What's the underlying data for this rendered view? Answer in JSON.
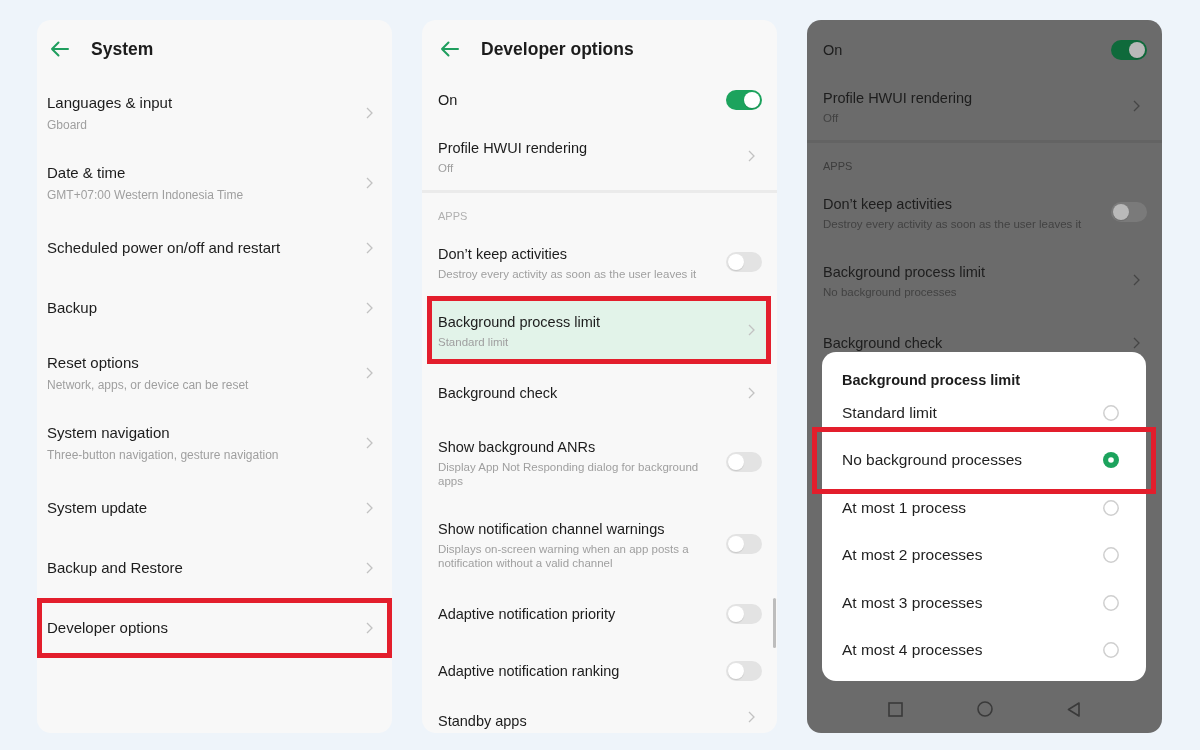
{
  "panels": [
    {
      "header": {
        "title": "System"
      },
      "items": [
        {
          "kind": "link",
          "title": "Languages & input",
          "subtitle": "Gboard",
          "highlighted": false
        },
        {
          "kind": "link",
          "title": "Date & time",
          "subtitle": "GMT+07:00 Western Indonesia Time",
          "highlighted": false
        },
        {
          "kind": "link",
          "title": "Scheduled power on/off and restart",
          "highlighted": false
        },
        {
          "kind": "link",
          "title": "Backup",
          "highlighted": false
        },
        {
          "kind": "link",
          "title": "Reset options",
          "subtitle": "Network, apps, or device can be reset",
          "highlighted": false
        },
        {
          "kind": "link",
          "title": "System navigation",
          "subtitle": "Three-button navigation, gesture navigation",
          "highlighted": false
        },
        {
          "kind": "link",
          "title": "System update",
          "highlighted": false
        },
        {
          "kind": "link",
          "title": "Backup and Restore",
          "highlighted": false
        },
        {
          "kind": "link",
          "title": "Developer options",
          "highlighted": true
        }
      ]
    },
    {
      "header": {
        "title": "Developer options"
      },
      "master_switch": {
        "title": "On",
        "on": true
      },
      "scrollbar": true,
      "items": [
        {
          "kind": "link",
          "title": "Profile HWUI rendering",
          "subtitle": "Off",
          "highlighted": false,
          "pressed": false
        },
        {
          "kind": "divider"
        },
        {
          "kind": "section",
          "title": "APPS"
        },
        {
          "kind": "switch",
          "title": "Don’t keep activities",
          "subtitle": "Destroy every activity as soon as the user leaves it",
          "on": false,
          "highlighted": false,
          "pressed": false
        },
        {
          "kind": "link",
          "title": "Background process limit",
          "subtitle": "Standard limit",
          "highlighted": true,
          "pressed": true
        },
        {
          "kind": "link",
          "title": "Background check",
          "highlighted": false,
          "pressed": false
        },
        {
          "kind": "switch",
          "title": "Show background ANRs",
          "subtitle": "Display App Not Responding dialog for background apps",
          "on": false,
          "highlighted": false,
          "pressed": false
        },
        {
          "kind": "switch",
          "title": "Show notification channel warnings",
          "subtitle": "Displays on-screen warning when an app posts a notification without a valid channel",
          "on": false,
          "highlighted": false,
          "pressed": false
        },
        {
          "kind": "switch",
          "title": "Adaptive notification priority",
          "on": false,
          "highlighted": false,
          "pressed": false
        },
        {
          "kind": "switch",
          "title": "Adaptive notification ranking",
          "on": false,
          "highlighted": false,
          "pressed": false
        },
        {
          "kind": "link",
          "title": "Standby apps",
          "highlighted": false,
          "pressed": false
        }
      ]
    },
    {
      "dimmed": true,
      "nav_bar": true,
      "master_switch": {
        "title": "On",
        "on": true
      },
      "items": [
        {
          "kind": "link",
          "title": "Profile HWUI rendering",
          "subtitle": "Off"
        },
        {
          "kind": "divider"
        },
        {
          "kind": "section",
          "title": "APPS"
        },
        {
          "kind": "switch",
          "title": "Don’t keep activities",
          "subtitle": "Destroy every activity as soon as the user leaves it",
          "on": false
        },
        {
          "kind": "link",
          "title": "Background process limit",
          "subtitle": "No background processes"
        },
        {
          "kind": "link",
          "title": "Background check"
        }
      ],
      "dialog": {
        "title": "Background process limit",
        "options": [
          {
            "label": "Standard limit",
            "selected": false,
            "highlighted": false
          },
          {
            "label": "No background processes",
            "selected": true,
            "highlighted": true
          },
          {
            "label": "At most 1 process",
            "selected": false,
            "highlighted": false
          },
          {
            "label": "At most 2 processes",
            "selected": false,
            "highlighted": false
          },
          {
            "label": "At most 3 processes",
            "selected": false,
            "highlighted": false
          },
          {
            "label": "At most 4 processes",
            "selected": false,
            "highlighted": false
          }
        ]
      }
    }
  ]
}
